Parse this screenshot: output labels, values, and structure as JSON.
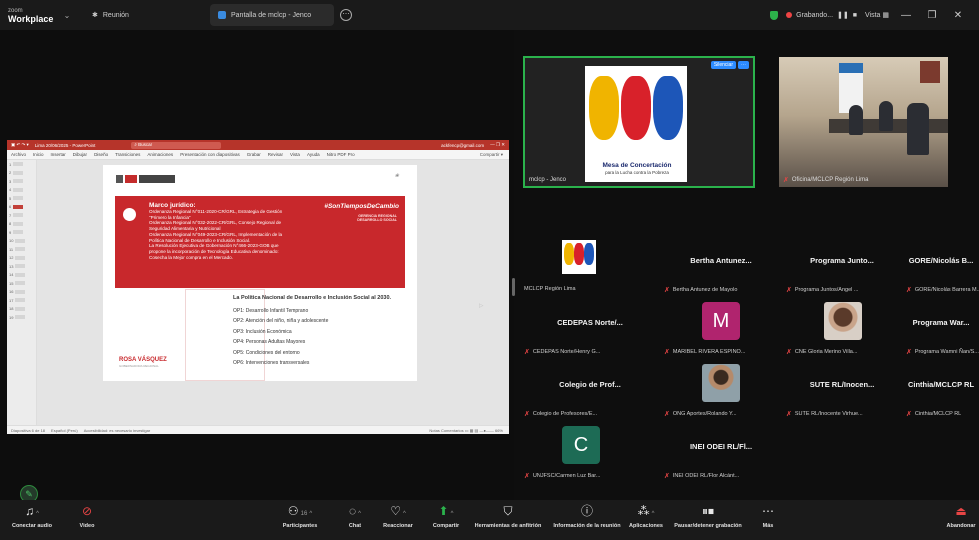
{
  "titlebar": {
    "brand_top": "zoom",
    "brand_bottom": "Workplace",
    "meeting_tab": "Reunión",
    "share_tab": "Pantalla de mclcp - Jenco",
    "recording": "Grabando...",
    "view": "Vista"
  },
  "presentation": {
    "window_title": "Lima 20/06/2025 - PowerPoint",
    "search_placeholder": "Buscar",
    "account": "ackfencp@gmail.com",
    "ribbon_tabs": [
      "Archivo",
      "Inicio",
      "Insertar",
      "Dibujar",
      "Diseño",
      "Transiciones",
      "Animaciones",
      "Presentación con diapositivas",
      "Grabar",
      "Revisar",
      "Vista",
      "Ayuda",
      "Nitro PDF Pro"
    ],
    "share_button": "Compartir",
    "hashtag": "#SonTiemposDeCambio",
    "gerencia": "GERENCIA REGIONAL DESARROLLO SOCIAL",
    "marco_title": "Marco jurídico:",
    "marco_lines": [
      "Ordenanza Regional N°011-2020-CR/GRL, Estrategia de Gestión",
      "\"Primero la Infancia\"",
      "Ordenanza Regional N°032-2022-CR/GRL, Consejo Regional de",
      "Seguridad Alimentaria y Nutricional",
      "Ordenanza Regional N°049-2023-CR/GRL, Implementación de la",
      "Política Nacional de Desarrollo e Inclusión Social.",
      "La Resolución Ejecutiva de Gobernación N°466-2023-GOB que",
      "propone la incorporación de Tecnología Educativa denominado:",
      "Cosecha la Mejor compra en el Mercado."
    ],
    "policy_title": "La Política Nacional de Desarrollo e Inclusión Social al 2030.",
    "ops": [
      "OP1: Desarrollo Infantil Temprano",
      "OP2: Atención del niño, niña y adolescente",
      "OP3: Inclusión Económica",
      "OP4: Personas Adultas Mayores",
      "OP5: Condiciones del entorno",
      "OP6: Intervenciones transversales"
    ],
    "governor": "ROSA VÁSQUEZ",
    "governor_sub": "GOBERNADORA REGIONAL",
    "status_left": "Diapositiva 6 de 18",
    "status_lang": "Español (Perú)",
    "status_access": "Accesibilidad: es necesario investigar",
    "status_notes": "Notas",
    "status_comments": "Comentarios",
    "zoom": "66%"
  },
  "gallery": {
    "main_tile": {
      "name": "mclcp - Jenco",
      "silence": "Silenciar",
      "logo_title": "Mesa de Concertación",
      "logo_sub": "para la Lucha contra la Pobreza"
    },
    "room_tile": {
      "name": "Oficina/MCLCP Región Lima"
    },
    "tiles": [
      {
        "title": "",
        "label": "MCLCP Región Lima",
        "muted": false
      },
      {
        "title": "Bertha Antunez...",
        "label": "Bertha Antunez de Mayolo",
        "muted": true
      },
      {
        "title": "Programa Junto...",
        "label": "Programa Juntos/Angel ...",
        "muted": true
      },
      {
        "title": "GORE/Nicolás B...",
        "label": "GORE/Nicolás Barrera M...",
        "muted": true
      },
      {
        "title": "CEDEPAS Norte/...",
        "label": "CEDEPAS Norte/Henry G...",
        "muted": true
      },
      {
        "title": "",
        "label": "MARIBEL RIVERA ESPINO...",
        "muted": true,
        "avatar": "M",
        "avatar_color": "#b0246e"
      },
      {
        "title": "",
        "label": "CNE Gloria Merino Villa...",
        "muted": true
      },
      {
        "title": "Programa War...",
        "label": "Programa Wamni Ñan/S...",
        "muted": true
      },
      {
        "title": "Colegio de Prof...",
        "label": "Colegio de Profesores/E...",
        "muted": true
      },
      {
        "title": "",
        "label": "ONG Aportes/Rolando Y...",
        "muted": true
      },
      {
        "title": "SUTE RL/Inocen...",
        "label": "SUTE RL/Inocente Virhue...",
        "muted": true
      },
      {
        "title": "Cinthia/MCLCP RL",
        "label": "Cinthia/MCLCP RL",
        "muted": true
      },
      {
        "title": "",
        "label": "UNJFSC/Carmen Luz Bar...",
        "muted": true,
        "avatar": "C",
        "avatar_color": "#1d6b55"
      },
      {
        "title": "INEI ODEI RL/Fl...",
        "label": "INEI ODEI RL/Flor Alcánt...",
        "muted": true
      }
    ]
  },
  "toolbar": {
    "audio": "Conectar audio",
    "video": "Video",
    "participants": "Participantes",
    "participants_count": "16",
    "chat": "Chat",
    "react": "Reaccionar",
    "share": "Compartir",
    "host_tools": "Herramientas de anfitrión",
    "info": "Información de la reunión",
    "apps": "Aplicaciones",
    "record": "Pausar/detener grabación",
    "more": "Más",
    "leave": "Abandonar"
  },
  "colors": {
    "accent_green": "#2bb24c",
    "muted_red": "#e84545",
    "slide_red": "#c8282c",
    "zoom_blue": "#2d8cff"
  }
}
